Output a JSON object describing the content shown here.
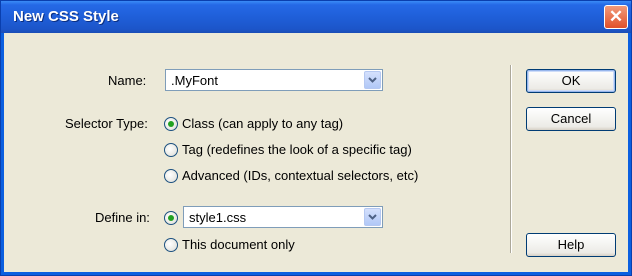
{
  "window": {
    "title": "New CSS Style",
    "close_icon": "close-icon"
  },
  "name_field": {
    "label": "Name:",
    "value": ".MyFont"
  },
  "selector_type": {
    "label": "Selector Type:",
    "options": [
      {
        "label": "Class (can apply to any tag)",
        "checked": true
      },
      {
        "label": "Tag (redefines the look of a specific tag)",
        "checked": false
      },
      {
        "label": "Advanced (IDs, contextual selectors, etc)",
        "checked": false
      }
    ]
  },
  "define_in": {
    "label": "Define in:",
    "file_value": "style1.css",
    "file_checked": true,
    "doc_only_label": "This document only",
    "doc_only_checked": false
  },
  "buttons": {
    "ok": "OK",
    "cancel": "Cancel",
    "help": "Help"
  },
  "colors": {
    "titlebar": "#1f5fd9",
    "close": "#e0502a",
    "radio_dot": "#21a121",
    "dialog_bg": "#ece9d8"
  }
}
